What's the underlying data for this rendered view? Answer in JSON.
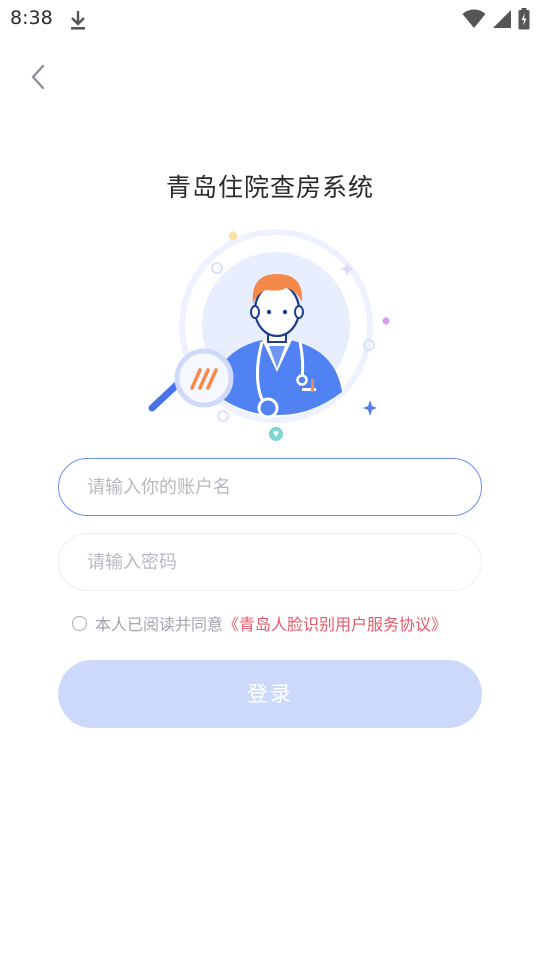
{
  "status_bar": {
    "time": "8:38",
    "icons": [
      "download-icon",
      "wifi-icon",
      "signal-icon",
      "battery-charging-icon"
    ]
  },
  "nav": {
    "back_icon": "chevron-left-icon"
  },
  "app_title": "青岛住院查房系统",
  "form": {
    "account_placeholder": "请输入你的账户名",
    "password_placeholder": "请输入密码",
    "agreement_prefix": "本人已阅读并同意",
    "agreement_link": "《青岛人脸识别用户服务协议》",
    "login_label": "登录"
  },
  "colors": {
    "accent_blue": "#6b8ef2",
    "login_button_disabled": "#ccd9fb",
    "link_red": "#e55a6b",
    "placeholder_gray": "#b8b8c0"
  }
}
